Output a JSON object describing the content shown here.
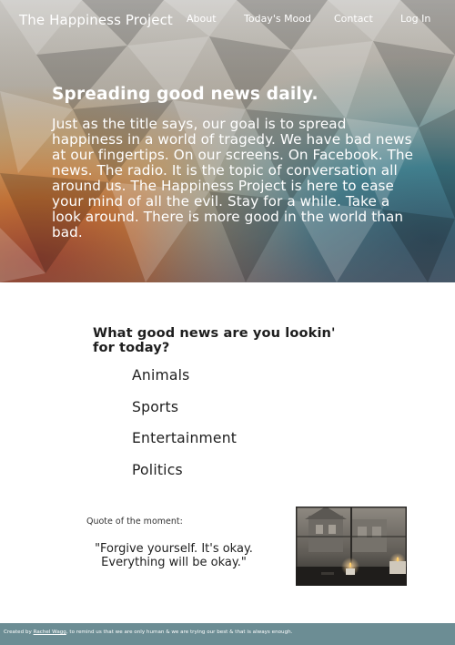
{
  "nav": {
    "brand": "The Happiness Project",
    "links": [
      "About",
      "Today's Mood",
      "Contact",
      "Log In"
    ]
  },
  "hero": {
    "title": "Spreading good news daily.",
    "body": "Just as the title says, our goal is to spread happiness in a world of tragedy. We have bad news at our fingertips. On our screens. On Facebook. The news. The radio. It is the topic of conversation all around us. The Happiness Project is here to ease your mind of all the evil. Stay for a while. Take a look around. There is more good in the world than bad."
  },
  "question": "What good news are you lookin' for today?",
  "categories": [
    "Animals",
    "Sports",
    "Entertainment",
    "Politics"
  ],
  "quote": {
    "label": "Quote of the moment:",
    "text": "\"Forgive yourself. It's okay. Everything will be okay.\""
  },
  "footer": {
    "prefix": "Created by",
    "author": "Rachel Wagg",
    "suffix": ", to remind us that we are only human & we are trying our best & that is always enough."
  },
  "colors": {
    "footer_bg": "#6c8d94",
    "hero_warm": "#e0772a",
    "hero_cool": "#2e7e95"
  }
}
